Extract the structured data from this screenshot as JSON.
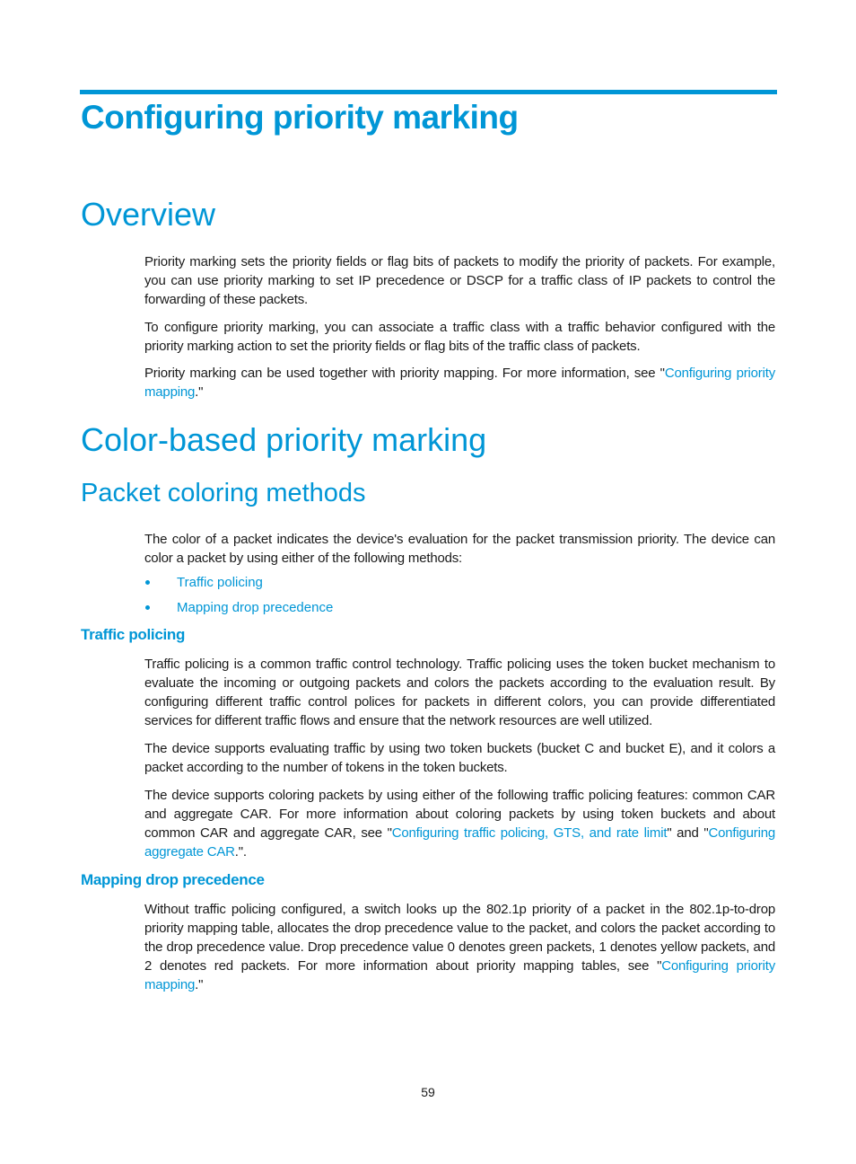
{
  "chapter": {
    "title": "Configuring priority marking"
  },
  "overview": {
    "heading": "Overview",
    "p1": "Priority marking sets the priority fields or flag bits of packets to modify the priority of packets. For example, you can use priority marking to set IP precedence or DSCP for a traffic class of IP packets to control the forwarding of these packets.",
    "p2": "To configure priority marking, you can associate a traffic class with a traffic behavior configured with the priority marking action to set the priority fields or flag bits of the traffic class of packets.",
    "p3_before": "Priority marking can be used together with priority mapping. For more information, see \"",
    "p3_link": "Configuring priority mapping",
    "p3_after": ".\""
  },
  "color_based": {
    "heading": "Color-based priority marking",
    "methods": {
      "heading": "Packet coloring methods",
      "intro": "The color of a packet indicates the device's evaluation for the packet transmission priority. The device can color a packet by using either of the following methods:",
      "bullets": [
        {
          "label": "Traffic policing"
        },
        {
          "label": "Mapping drop precedence"
        }
      ]
    },
    "traffic_policing": {
      "heading": "Traffic policing",
      "p1": "Traffic policing is a common traffic control technology. Traffic policing uses the token bucket mechanism to evaluate the incoming or outgoing packets and colors the packets according to the evaluation result. By configuring different traffic control polices for packets in different colors, you can provide differentiated services for different traffic flows and ensure that the network resources are well utilized.",
      "p2": "The device supports evaluating traffic by using two token buckets (bucket C and bucket E), and it colors a packet according to the number of tokens in the token buckets.",
      "p3_before": "The device supports coloring packets by using either of the following traffic policing features: common CAR and aggregate CAR. For more information about coloring packets by using token buckets and about common CAR and aggregate CAR, see \"",
      "p3_link1": "Configuring traffic policing, GTS, and rate limit",
      "p3_middle": "\" and \"",
      "p3_link2": "Configuring aggregate CAR",
      "p3_after": ".\"."
    },
    "mapping_drop": {
      "heading": "Mapping drop precedence",
      "p1_before": "Without traffic policing configured, a switch looks up the 802.1p priority of a packet in the 802.1p-to-drop priority mapping table, allocates the drop precedence value to the packet, and colors the packet according to the drop precedence value. Drop precedence value 0 denotes green packets, 1 denotes yellow packets, and 2 denotes red packets. For more information about priority mapping tables, see \"",
      "p1_link": "Configuring priority mapping",
      "p1_after": ".\""
    }
  },
  "footer": {
    "page_number": "59"
  },
  "colors": {
    "accent": "#0096d6",
    "text": "#1a1a1a"
  }
}
